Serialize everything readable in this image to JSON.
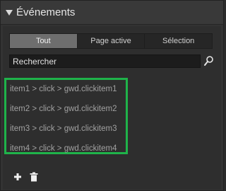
{
  "panel": {
    "title": "Événements",
    "collapse_icon": "triangle-down-icon"
  },
  "tabs": [
    {
      "label": "Tout",
      "active": true
    },
    {
      "label": "Page active",
      "active": false
    },
    {
      "label": "Sélection",
      "active": false
    }
  ],
  "search": {
    "placeholder": "Rechercher",
    "value": "",
    "icon": "search-icon"
  },
  "events": [
    {
      "label": "item1 > click > gwd.clickitem1"
    },
    {
      "label": "item2 > click > gwd.clickitem2"
    },
    {
      "label": "item3 > click > gwd.clickitem3"
    },
    {
      "label": "item4 > click > gwd.clickitem4"
    }
  ],
  "toolbar": {
    "add_icon": "plus-icon",
    "delete_icon": "trash-icon"
  },
  "colors": {
    "highlight": "#1fb34a",
    "active_tab": "#6e6e6e"
  }
}
